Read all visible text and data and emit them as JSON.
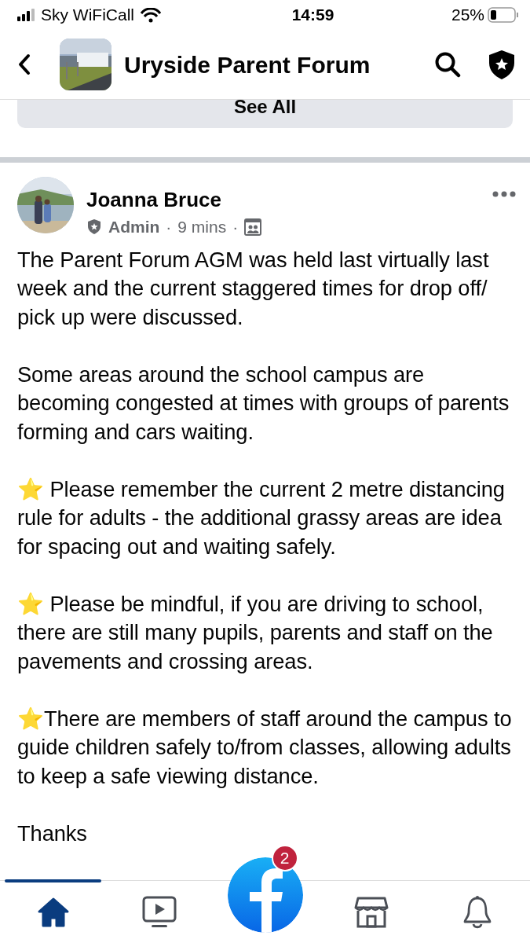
{
  "status_bar": {
    "carrier": "Sky WiFiCall",
    "time": "14:59",
    "battery": "25%"
  },
  "header": {
    "title": "Uryside Parent Forum"
  },
  "see_all": {
    "label": "See All"
  },
  "post": {
    "author": "Joanna Bruce",
    "role": "Admin",
    "separator_1": "·",
    "time": "9 mins",
    "separator_2": "·",
    "paragraphs": [
      {
        "text": "The Parent Forum AGM was held last virtually last week and the current staggered times for drop off/ pick up were discussed."
      },
      {
        "text": "Some areas around the school campus are becoming congested at times with groups of parents forming and cars waiting."
      },
      {
        "text": "⭐ Please remember the current 2 metre distancing rule for adults - the additional grassy areas are idea for spacing out and waiting safely."
      },
      {
        "text": "⭐ Please be mindful, if you are driving to school, there are still many pupils, parents and staff on the pavements and crossing areas."
      },
      {
        "text": "⭐There are members of staff around the campus to guide children safely to/from classes, allowing adults to keep a safe viewing distance."
      },
      {
        "text": "Thanks"
      }
    ]
  },
  "bottom_nav": {
    "badge": "2",
    "tabs": [
      {
        "kind": "home",
        "selected": true
      },
      {
        "kind": "video",
        "selected": false
      },
      {
        "kind": "logo",
        "selected": false
      },
      {
        "kind": "marketplace",
        "selected": false
      },
      {
        "kind": "notifications",
        "selected": false
      }
    ]
  }
}
